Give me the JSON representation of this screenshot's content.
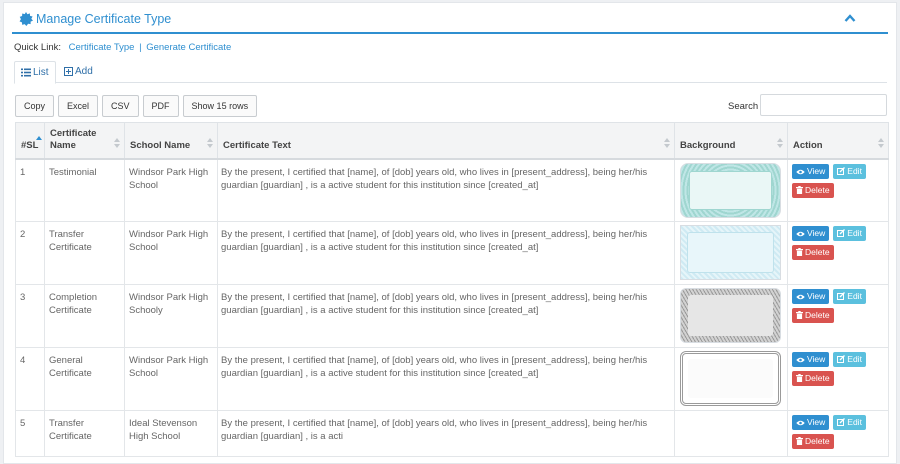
{
  "header": {
    "title": "Manage Certificate Type"
  },
  "quick_link": {
    "label": "Quick Link:",
    "links": [
      "Certificate Type",
      "Generate Certificate"
    ],
    "separator": "|"
  },
  "tabs": [
    {
      "label": "List",
      "icon": "list-icon",
      "active": true
    },
    {
      "label": "Add",
      "icon": "plus-square-icon",
      "active": false
    }
  ],
  "toolbar": {
    "buttons": [
      "Copy",
      "Excel",
      "CSV",
      "PDF",
      "Show 15 rows"
    ],
    "search_label": "Search"
  },
  "table": {
    "columns": [
      "#SL",
      "Certificate Name",
      "School Name",
      "Certificate Text",
      "Background",
      "Action"
    ],
    "rows": [
      {
        "sl": "1",
        "name": "Testimonial",
        "school": "Windsor Park High School",
        "text": "By the present, I certified that [name], of [dob] years old, who lives in [present_address], being her/his guardian [guardian] , is a active student for this institution since [created_at]",
        "background": "blue-green-wavy-border"
      },
      {
        "sl": "2",
        "name": "Transfer Certificate",
        "school": "Windsor Park High School",
        "text": "By the present, I certified that [name], of [dob] years old, who lives in [present_address], being her/his guardian [guardian] , is a active student for this institution since [created_at]",
        "background": "light-blue-pattern"
      },
      {
        "sl": "3",
        "name": "Completion Certificate",
        "school": "Windsor Park High Schooly",
        "text": "By the present, I certified that [name], of [dob] years old, who lives in [present_address], being her/his guardian [guardian] , is a active student for this institution since [created_at]",
        "background": "grey-guilloche-border"
      },
      {
        "sl": "4",
        "name": "General Certificate",
        "school": "Windsor Park High School",
        "text": "By the present, I certified that [name], of [dob] years old, who lives in [present_address], being her/his guardian [guardian] , is a active student for this institution since [created_at]",
        "background": "white-grey-border"
      },
      {
        "sl": "5",
        "name": "Transfer Certificate",
        "school": "Ideal Stevenson High School",
        "text": "By the present, I certified that [name], of [dob] years old, who lives in [present_address], being her/his guardian [guardian] , is a acti",
        "background": ""
      }
    ],
    "actions": {
      "view": "View",
      "edit": "Edit",
      "delete": "Delete"
    }
  },
  "colors": {
    "accent": "#2f8fd0",
    "view": "#2f8fd0",
    "edit": "#5bc0de",
    "delete": "#d9534f"
  }
}
